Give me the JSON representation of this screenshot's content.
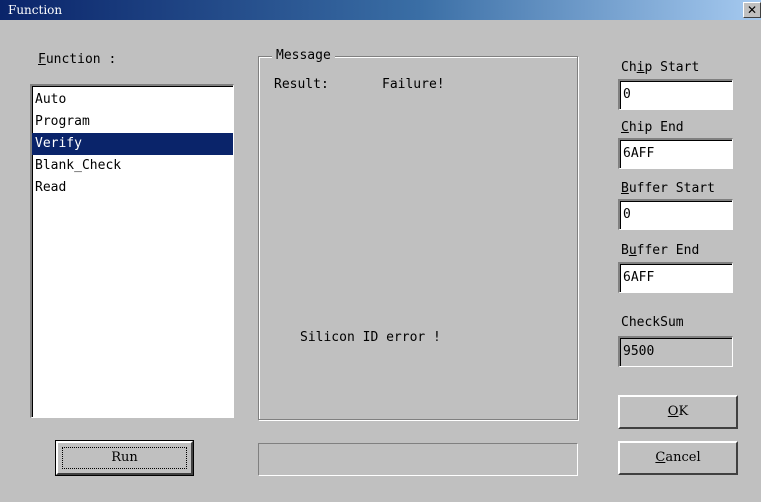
{
  "window": {
    "title": "Function",
    "close_glyph": "✕"
  },
  "function_panel": {
    "label_mnemonic": "F",
    "label_rest": "unction :",
    "items": [
      "Auto",
      "Program",
      "Verify",
      "Blank_Check",
      "Read"
    ],
    "selected_index": 2
  },
  "message": {
    "group_label": "Message",
    "result_label": "Result:",
    "result_value": "Failure!",
    "error_text": "Silicon ID error !"
  },
  "fields": {
    "chip_start": {
      "label_pre": "Ch",
      "mnemonic": "i",
      "label_post": "p Start",
      "value": "0"
    },
    "chip_end": {
      "label_pre": "",
      "mnemonic": "C",
      "label_post": "hip End",
      "value": "6AFF"
    },
    "buffer_start": {
      "label_pre": "",
      "mnemonic": "B",
      "label_post": "uffer Start",
      "value": "0"
    },
    "buffer_end": {
      "label_pre": "B",
      "mnemonic": "u",
      "label_post": "ffer End",
      "value": "6AFF"
    },
    "checksum": {
      "label": "CheckSum",
      "value": "9500"
    }
  },
  "buttons": {
    "run": "Run",
    "ok_mnemonic": "O",
    "ok_rest": "K",
    "cancel_mnemonic": "C",
    "cancel_rest": "ancel"
  },
  "progress": {
    "value": 0
  },
  "colors": {
    "face": "#c0c0c0",
    "selection": "#0a246a",
    "title_start": "#0a246a"
  }
}
